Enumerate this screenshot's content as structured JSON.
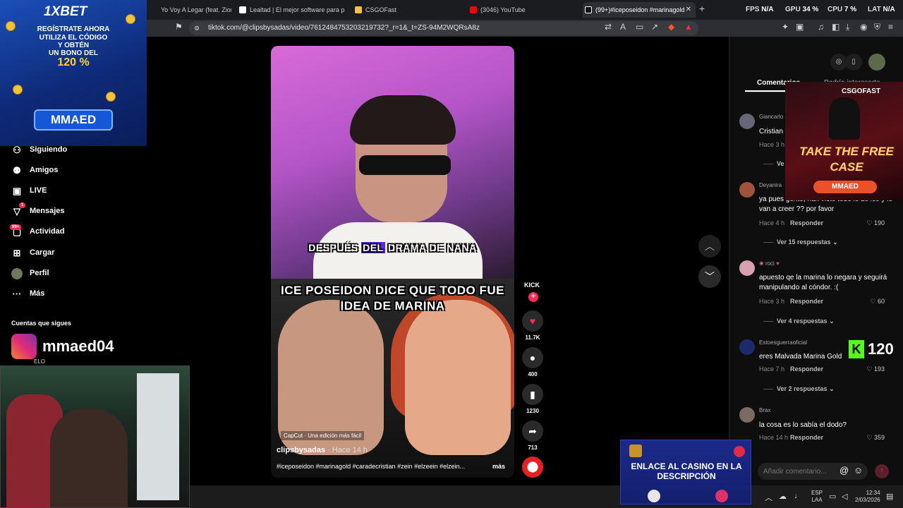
{
  "tabs": [
    {
      "label": "Yo Voy A Legar (feat. Zion) - Y",
      "active": false
    },
    {
      "label": "Lealtad | El mejor software para pote",
      "active": false
    },
    {
      "label": "CSGOFast",
      "active": false
    },
    {
      "label": "(3046) YouTube",
      "active": false
    },
    {
      "label": "(99+)#iceposeidon #marinagold",
      "active": true
    }
  ],
  "perf": {
    "fps_label": "FPS",
    "fps_value": "N/A",
    "gpu_label": "GPU",
    "gpu_value": "34 %",
    "cpu_label": "CPU",
    "cpu_value": "7 %",
    "lat_label": "LAT",
    "lat_value": "N/A"
  },
  "url": "tiktok.com/@clipsbysadas/video/7612484753203219732?_r=1&_t=ZS-94M2WQRsA8z",
  "ad_1xbet": {
    "logo": "1XBET",
    "line1": "REGÍSTRATE AHORA",
    "line2": "UTILIZA EL CÓDIGO",
    "line3": "Y OBTÉN",
    "line4": "UN BONO DEL",
    "percent": "120 %",
    "code": "MMAED"
  },
  "sidebar": {
    "items": [
      {
        "label": "Siguiendo",
        "icon": "user-follow-icon"
      },
      {
        "label": "Amigos",
        "icon": "friends-icon"
      },
      {
        "label": "LIVE",
        "icon": "live-tv-icon"
      },
      {
        "label": "Mensajes",
        "icon": "messages-icon",
        "badge": "1"
      },
      {
        "label": "Actividad",
        "icon": "activity-icon",
        "badge": "99+"
      },
      {
        "label": "Cargar",
        "icon": "upload-icon"
      },
      {
        "label": "Perfil",
        "icon": "profile-avatar"
      },
      {
        "label": "Más",
        "icon": "more-icon"
      }
    ],
    "following_title": "Cuentas que sigues",
    "following_name": "mmaed04",
    "following_sub": "ELO"
  },
  "video": {
    "caption1_a": "DESPUÉS ",
    "caption1_hl": "DEL",
    "caption1_b": " DRAMA DE NANA",
    "caption2": "ICE POSEIDON DICE QUE TODO FUE IDEA DE MARINA",
    "capcut": "CapCut · Una edición más fácil",
    "author": "clipsbysadas",
    "time": " · Hace 14 h",
    "tags": "#iceposeidon #marinagold #caradecristian #zein #elzeein #elzein...",
    "more": "más"
  },
  "actions": {
    "kick": "KICK",
    "likes": "11.7K",
    "comments": "400",
    "saves": "1230",
    "shares": "713"
  },
  "comments_panel": {
    "tab_comments": "Comentarios",
    "tab_interest": "Podría interesarte",
    "input_placeholder": "Añadir comentario...",
    "items": [
      {
        "user": "Giancarlo",
        "text": "Cristian",
        "time": "Hace 3 h",
        "view": "Ve"
      },
      {
        "user": "Deyanira",
        "text": "ya pues gente, han visto todo lo de ice y le van a creer ?? por favor",
        "time": "Hace 4 h",
        "reply": "Responder",
        "likes": "190",
        "view": "Ver 15 respuestas"
      },
      {
        "user": "roci",
        "text": "apuesto qe la marina lo negara y seguirá manipulando al cóndor. :(",
        "time": "Hace 3 h",
        "reply": "Responder",
        "likes": "60",
        "view": "Ver 4 respuestas"
      },
      {
        "user": "Estoesguerraoficial",
        "text": "eres Malvada Marina Gold",
        "time": "Hace 7 h",
        "reply": "Responder",
        "likes": "193",
        "view": "Ver 2 respuestas"
      },
      {
        "user": "Brax",
        "text": "la cosa es lo sabía el dodo?",
        "time": "Hace 14 h",
        "reply": "Responder",
        "likes": "359"
      }
    ]
  },
  "ad_csgo": {
    "logo": "CSGOFAST",
    "headline": "TAKE THE FREE CASE",
    "code": "MMAED"
  },
  "kick_badge": {
    "letter": "K",
    "value": "120"
  },
  "ad_casino": {
    "text": "ENLACE AL CASINO EN LA DESCRIPCIÓN"
  },
  "taskbar": {
    "lang1": "ESP",
    "lang2": "LAA",
    "time": "12:34",
    "date": "2/03/2026"
  },
  "colors": {
    "accent": "#fe2c55",
    "kick_green": "#53fc18",
    "background": "#000000"
  }
}
